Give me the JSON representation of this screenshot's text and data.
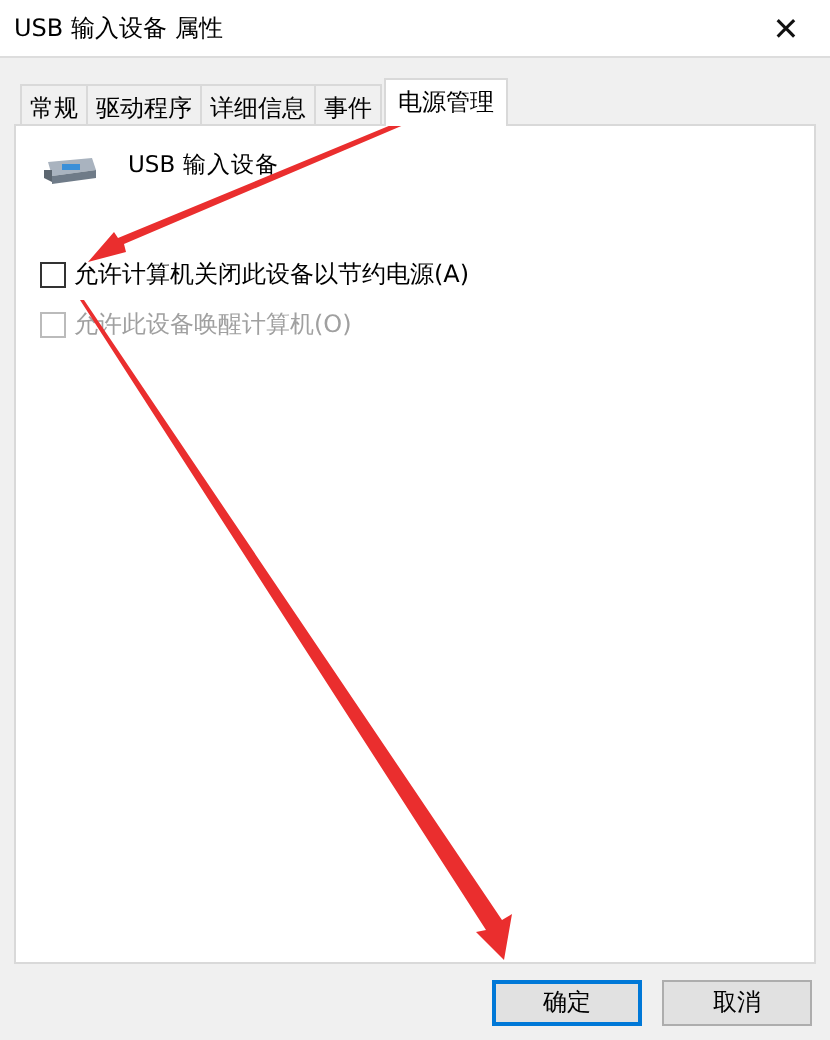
{
  "window": {
    "title": "USB 输入设备 属性",
    "close": "✕"
  },
  "tabs": [
    {
      "label": "常规",
      "selected": false
    },
    {
      "label": "驱动程序",
      "selected": false
    },
    {
      "label": "详细信息",
      "selected": false
    },
    {
      "label": "事件",
      "selected": false
    },
    {
      "label": "电源管理",
      "selected": true
    }
  ],
  "device": {
    "name": "USB 输入设备"
  },
  "options": [
    {
      "label": "允许计算机关闭此设备以节约电源(A)",
      "checked": false,
      "disabled": false
    },
    {
      "label": "允许此设备唤醒计算机(O)",
      "checked": false,
      "disabled": true
    }
  ],
  "buttons": [
    {
      "label": "确定",
      "default": true
    },
    {
      "label": "取消",
      "default": false
    }
  ]
}
